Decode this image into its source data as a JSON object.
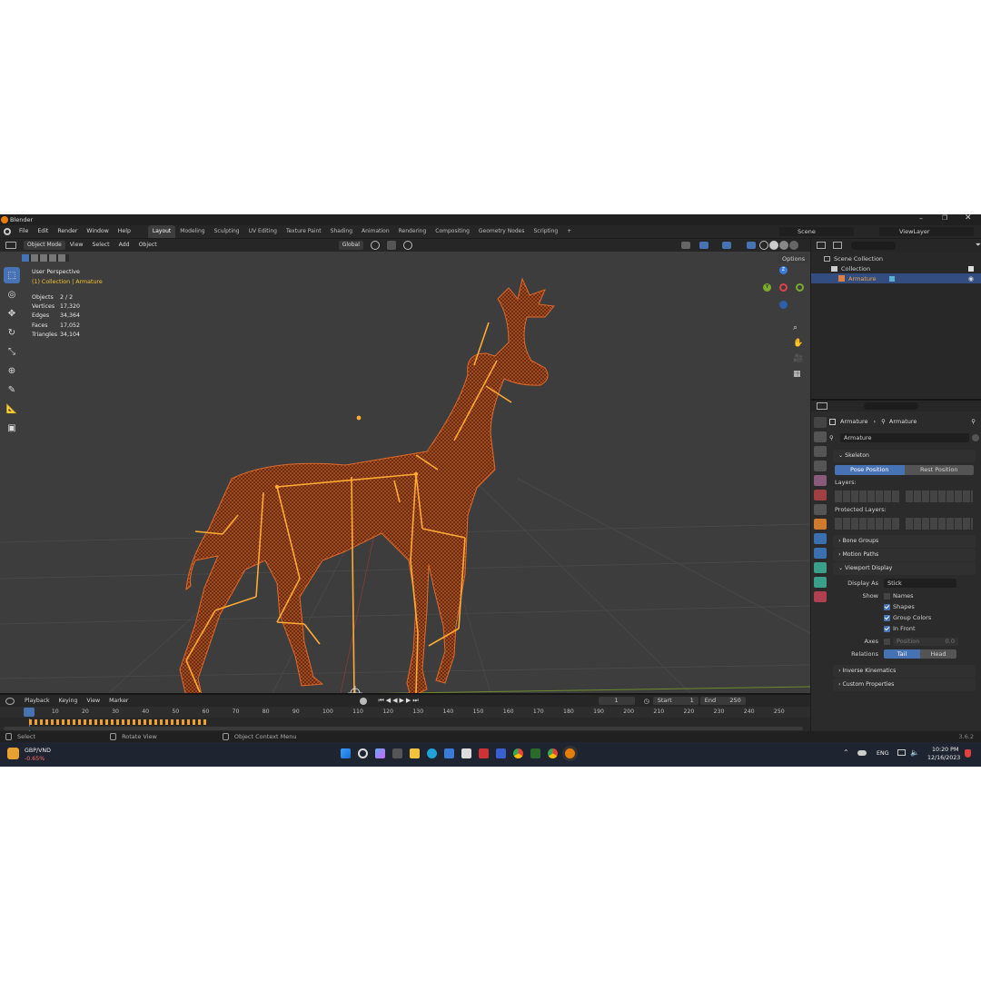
{
  "app": {
    "title": "Blender",
    "version": "3.6.2"
  },
  "menu": {
    "items": [
      "File",
      "Edit",
      "Render",
      "Window",
      "Help"
    ]
  },
  "workspaces": [
    "Layout",
    "Modeling",
    "Sculpting",
    "UV Editing",
    "Texture Paint",
    "Shading",
    "Animation",
    "Rendering",
    "Compositing",
    "Geometry Nodes",
    "Scripting"
  ],
  "workspace_add": "+",
  "scene": {
    "label": "Scene",
    "view_layer": "ViewLayer"
  },
  "viewport": {
    "mode": "Object Mode",
    "menus": [
      "View",
      "Select",
      "Add",
      "Object"
    ],
    "orientation": "Global",
    "options": "Options",
    "perspective": "User Perspective",
    "collection_path": "(1) Collection | Armature",
    "gizmo": {
      "x": "X",
      "y": "Y",
      "z": "Z"
    },
    "stats": [
      {
        "label": "Objects",
        "value": "2 / 2"
      },
      {
        "label": "Vertices",
        "value": "17,320"
      },
      {
        "label": "Edges",
        "value": "34,364"
      },
      {
        "label": "Faces",
        "value": "17,052"
      },
      {
        "label": "Triangles",
        "value": "34,104"
      }
    ]
  },
  "outliner": {
    "items": [
      {
        "label": "Scene Collection"
      },
      {
        "label": "Collection"
      },
      {
        "label": "Armature"
      }
    ]
  },
  "properties": {
    "breadcrumb": [
      "Armature",
      "Armature"
    ],
    "name_field": "Armature",
    "skeleton": {
      "title": "Skeleton",
      "pose_position": "Pose Position",
      "rest_position": "Rest Position",
      "layers": "Layers:",
      "protected_layers": "Protected Layers:"
    },
    "sections_collapsed": [
      "Bone Groups",
      "Motion Paths"
    ],
    "viewport_display": {
      "title": "Viewport Display",
      "display_as_label": "Display As",
      "display_as_value": "Stick",
      "show_label": "Show",
      "names": "Names",
      "shapes": "Shapes",
      "group_colors": "Group Colors",
      "in_front": "In Front",
      "axes_label": "Axes",
      "position_label": "Position",
      "position_value": "0.0",
      "relations_label": "Relations",
      "tail": "Tail",
      "head": "Head"
    },
    "sections_bottom": [
      "Inverse Kinematics",
      "Custom Properties"
    ]
  },
  "timeline": {
    "menus": [
      "Playback",
      "Keying",
      "View",
      "Marker"
    ],
    "current_frame": "1",
    "start_label": "Start",
    "start_value": "1",
    "end_label": "End",
    "end_value": "250",
    "ruler": [
      "1",
      "10",
      "20",
      "30",
      "40",
      "50",
      "60",
      "70",
      "80",
      "90",
      "100",
      "110",
      "120",
      "130",
      "140",
      "150",
      "160",
      "170",
      "180",
      "190",
      "200",
      "210",
      "220",
      "230",
      "240",
      "250"
    ]
  },
  "status": {
    "hints": [
      "Select",
      "Rotate View",
      "Object Context Menu"
    ]
  },
  "taskbar": {
    "ticker_name": "GBP/VND",
    "ticker_change": "-0.65%",
    "language": "ENG",
    "time": "10:20 PM",
    "date": "12/16/2023"
  },
  "colors": {
    "accent": "#4772b3",
    "wire": "#c9531c",
    "bone": "#ffaa33"
  }
}
